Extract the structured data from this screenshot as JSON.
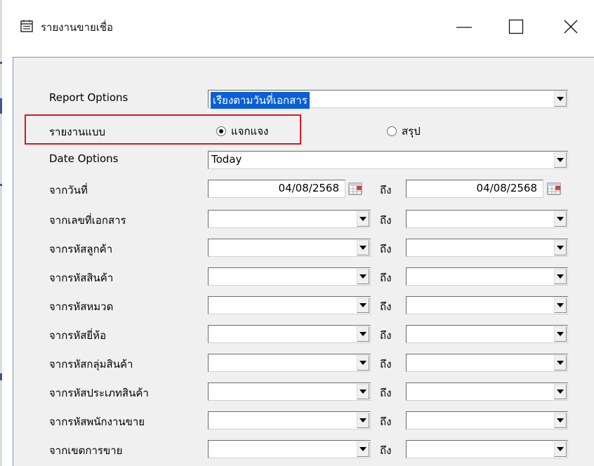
{
  "window": {
    "title": "รายงานขายเชื่อ",
    "minimize_glyph": "—",
    "maximize_glyph": "☐",
    "close_glyph": "✕"
  },
  "form": {
    "report_options": {
      "label": "Report Options",
      "value": "เรียงตามวันที่เอกสาร"
    },
    "report_type": {
      "label": "รายงานแบบ",
      "options": [
        "แจกแจง",
        "สรุป"
      ],
      "selected": "แจกแจง"
    },
    "date_options": {
      "label": "Date Options",
      "value": "Today"
    },
    "date_range": {
      "label": "จากวันที่",
      "from": "04/08/2568",
      "to_label": "ถึง",
      "to": "04/08/2568"
    },
    "range_rows": [
      {
        "label": "จากเลขที่เอกสาร",
        "to_label": "ถึง"
      },
      {
        "label": "จากรหัสลูกค้า",
        "to_label": "ถึง"
      },
      {
        "label": "จากรหัสสินค้า",
        "to_label": "ถึง"
      },
      {
        "label": "จากรหัสหมวด",
        "to_label": "ถึง"
      },
      {
        "label": "จากรหัสยี่ห้อ",
        "to_label": "ถึง"
      },
      {
        "label": "จากรหัสกลุ่มสินค้า",
        "to_label": "ถึง"
      },
      {
        "label": "จากรหัสประเภทสินค้า",
        "to_label": "ถึง"
      },
      {
        "label": "จากรหัสพนักงานขาย",
        "to_label": "ถึง"
      },
      {
        "label": "จากเขตการขาย",
        "to_label": "ถึง"
      }
    ]
  },
  "colors": {
    "highlight_border": "#e0141e",
    "selection_bg": "#0a5fd7",
    "panel_bg": "#f0f0f0"
  },
  "icons": {
    "app": "calendar-list-icon",
    "date_picker": "calendar-icon",
    "dropdown": "chevron-down-icon"
  }
}
